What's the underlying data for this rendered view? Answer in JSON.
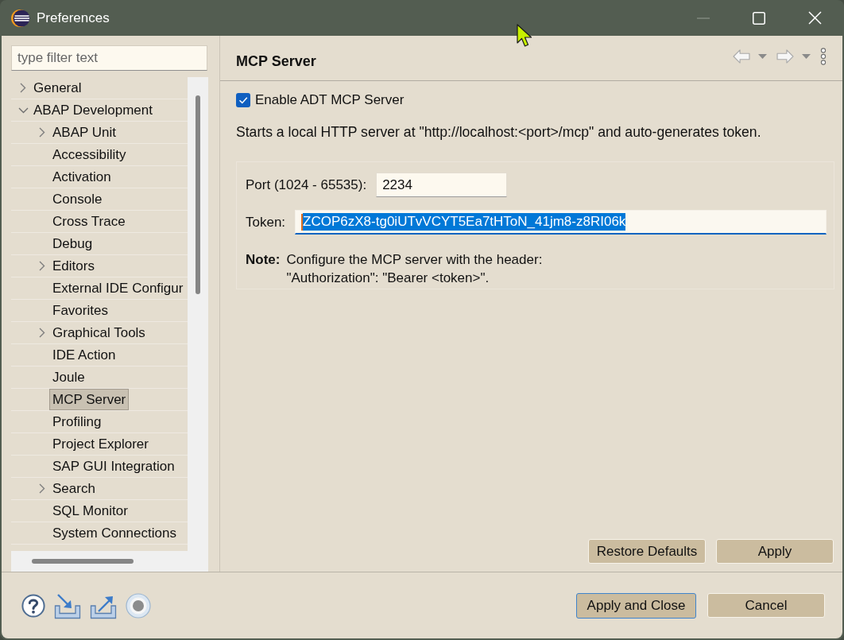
{
  "window": {
    "title": "Preferences",
    "controls": [
      {
        "kind": "minimize",
        "disabled": true
      },
      {
        "kind": "maximize",
        "disabled": false
      },
      {
        "kind": "close",
        "disabled": false
      }
    ]
  },
  "sidebar": {
    "filter": {
      "placeholder": "type filter text"
    },
    "tree": [
      {
        "label": "General",
        "expanded": false,
        "selected": false
      },
      {
        "label": "ABAP Development",
        "expanded": true,
        "selected": false,
        "children": [
          {
            "label": "ABAP Unit",
            "expanded": false,
            "selected": false
          },
          {
            "label": "Accessibility",
            "selected": false
          },
          {
            "label": "Activation",
            "selected": false
          },
          {
            "label": "Console",
            "selected": false
          },
          {
            "label": "Cross Trace",
            "selected": false
          },
          {
            "label": "Debug",
            "selected": false
          },
          {
            "label": "Editors",
            "expanded": false,
            "selected": false
          },
          {
            "label": "External IDE Configur",
            "selected": false
          },
          {
            "label": "Favorites",
            "selected": false
          },
          {
            "label": "Graphical Tools",
            "expanded": false,
            "selected": false
          },
          {
            "label": "IDE Action",
            "selected": false
          },
          {
            "label": "Joule",
            "selected": false
          },
          {
            "label": "MCP Server",
            "selected": true
          },
          {
            "label": "Profiling",
            "selected": false
          },
          {
            "label": "Project Explorer",
            "selected": false
          },
          {
            "label": "SAP GUI Integration",
            "selected": false
          },
          {
            "label": "Search",
            "expanded": false,
            "selected": false
          },
          {
            "label": "SQL Monitor",
            "selected": false
          },
          {
            "label": "System Connections",
            "selected": false
          }
        ]
      }
    ]
  },
  "page": {
    "title": "MCP Server",
    "nav": [
      {
        "kind": "back",
        "disabled": true
      },
      {
        "kind": "forward",
        "disabled": true
      }
    ],
    "enable": {
      "label": "Enable ADT MCP Server",
      "checked": true
    },
    "description": "Starts a local HTTP server at \"http://localhost:<port>/mcp\" and auto-generates token.",
    "port": {
      "label": "Port (1024 - 65535):",
      "value": "2234"
    },
    "token": {
      "label": "Token:",
      "value": "ZCOP6zX8-tg0iUTvVCYT5Ea7tHToN_41jm8-z8RI06k",
      "focused": true,
      "text_selected": true
    },
    "note": {
      "label": "Note:",
      "text": "Configure the MCP server with the header:\n\"Authorization\": \"Bearer <token>\"."
    },
    "buttons": [
      {
        "label": "Restore Defaults"
      },
      {
        "label": "Apply"
      }
    ]
  },
  "dialog_buttons": [
    {
      "label": "Apply and Close",
      "default": true
    },
    {
      "label": "Cancel",
      "default": false
    }
  ]
}
